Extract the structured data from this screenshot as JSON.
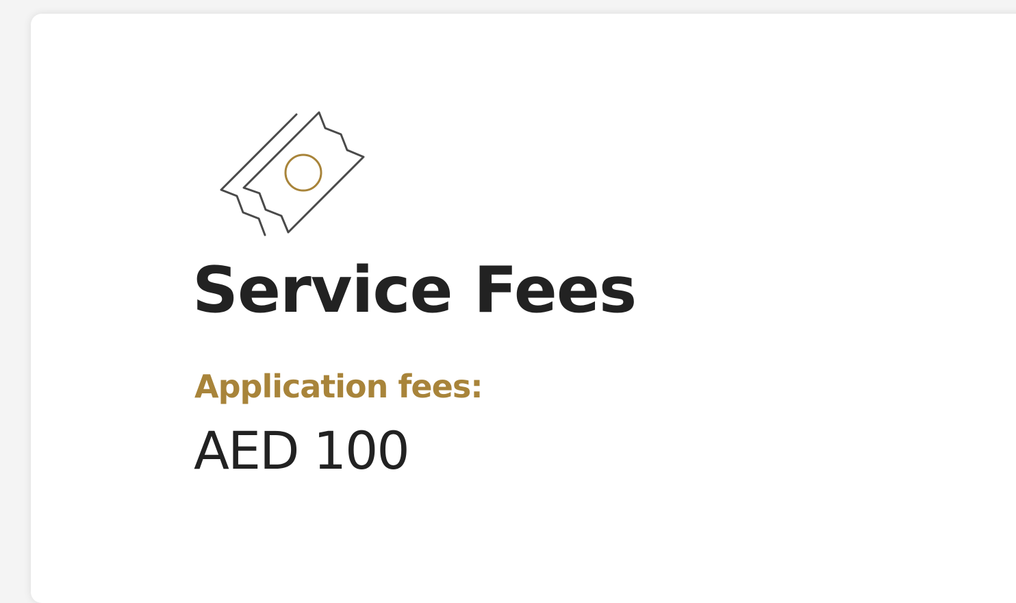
{
  "service_fees": {
    "icon": "ticket-icon",
    "title": "Service Fees",
    "application_fee_label": "Application fees:",
    "application_fee_value": "AED 100"
  },
  "colors": {
    "accent": "#a8843a",
    "text": "#222222",
    "icon_stroke": "#4a4a4a",
    "card_background": "#ffffff",
    "page_background": "#f4f4f4"
  }
}
